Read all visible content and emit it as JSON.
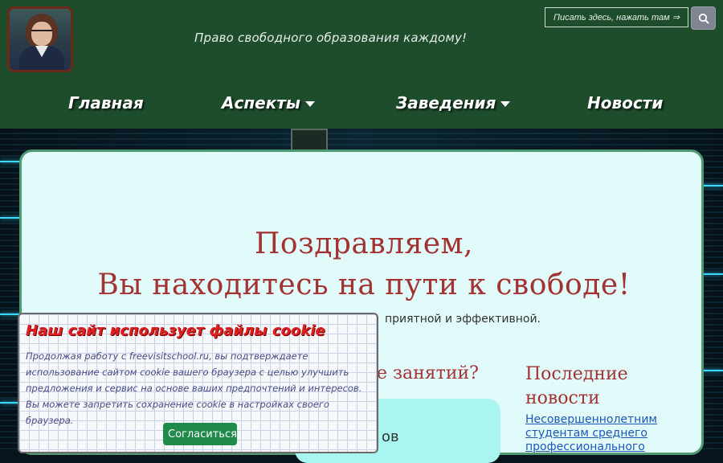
{
  "header": {
    "tagline": "Право свободного образования каждому!",
    "search_placeholder": "Писать здесь, нажать там ⇒",
    "search_button_icon": "search-icon",
    "avatar": "teacher-portrait"
  },
  "nav": {
    "items": [
      {
        "label": "Главная",
        "has_dropdown": false
      },
      {
        "label": "Аспекты",
        "has_dropdown": true
      },
      {
        "label": "Заведения",
        "has_dropdown": true
      },
      {
        "label": "Новости",
        "has_dropdown": false
      }
    ]
  },
  "main": {
    "hero_line1": "Поздравляем,",
    "hero_line2": "Вы находитесь на пути к свободе!",
    "hero_sub_visible": "приятной и эффективной.",
    "section_title_visible": "е занятий?",
    "teal_box_text_visible": "ов"
  },
  "news": {
    "title": "Последние новости",
    "link_text": "Несовершеннолетним студентам среднего профессионального"
  },
  "cookie": {
    "title": "Наш сайт использует файлы cookie",
    "text": "Продолжая работу с freevisitschool.ru, вы подтверждаете использование сайтом cookie вашего браузера с целью улучшить предложения и сервис на основе ваших предпочтений и интересов. Вы можете запретить сохранение cookie в настройках своего браузера.",
    "accept_label": "Согласиться"
  },
  "colors": {
    "header_bg": "#1d4d2b",
    "card_bg": "#e1fafa",
    "hero_text": "#a33232",
    "accent_button": "#1f8a4a",
    "link": "#1d57b7"
  }
}
